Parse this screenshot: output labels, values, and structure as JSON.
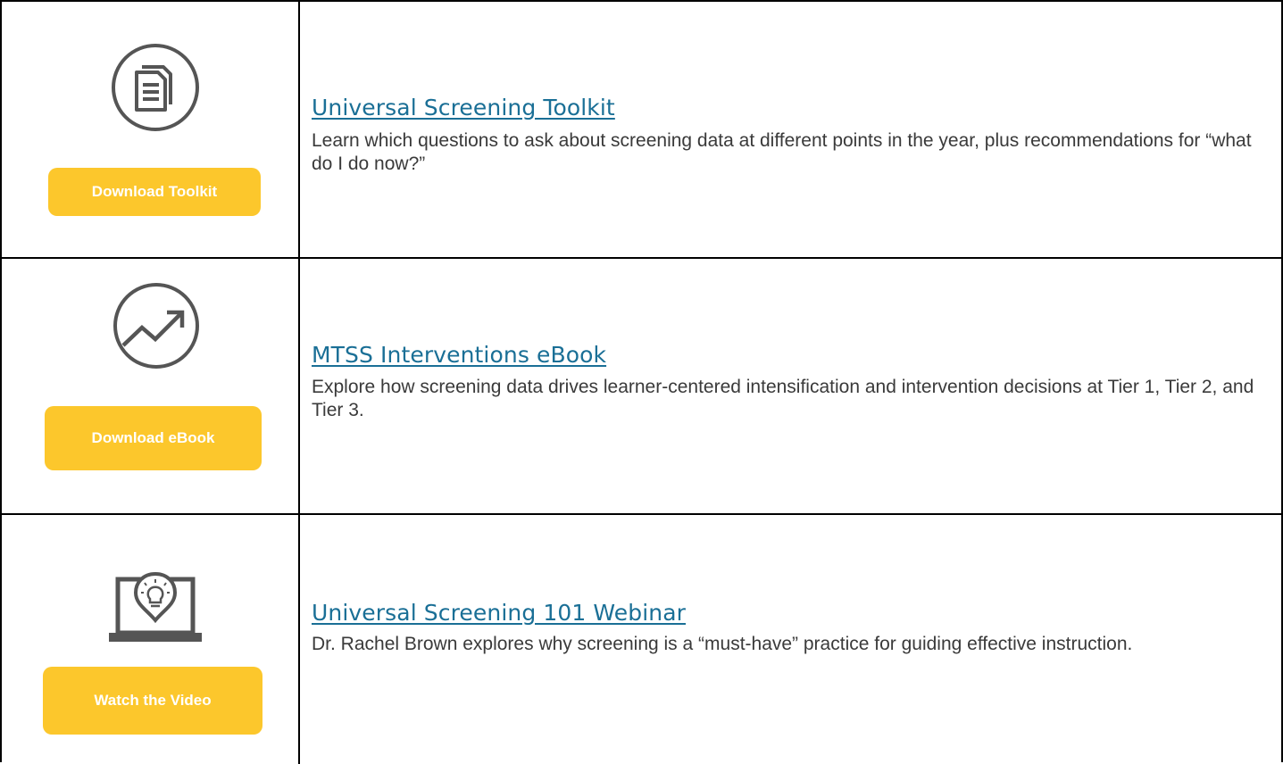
{
  "resources": [
    {
      "icon": "documents-icon",
      "button_label": "Download Toolkit",
      "title": "Universal Screening Toolkit",
      "description": "Learn which questions to ask about screening data at different points in the year, plus recommendations for “what do I do now?”"
    },
    {
      "icon": "trend-up-chart-icon",
      "button_label": "Download eBook",
      "title": "MTSS Interventions eBook",
      "description": "Explore how screening data drives learner-centered intensification and intervention decisions at Tier 1, Tier 2, and Tier 3."
    },
    {
      "icon": "laptop-lightbulb-icon",
      "button_label": "Watch the Video",
      "title": "Universal Screening 101 Webinar",
      "description": "Dr. Rachel Brown explores why screening is a “must-have” practice for guiding effective instruction."
    }
  ],
  "colors": {
    "button_bg": "#fcc72c",
    "link": "#1a6f96",
    "text": "#3a3a3a",
    "icon": "#555555"
  }
}
